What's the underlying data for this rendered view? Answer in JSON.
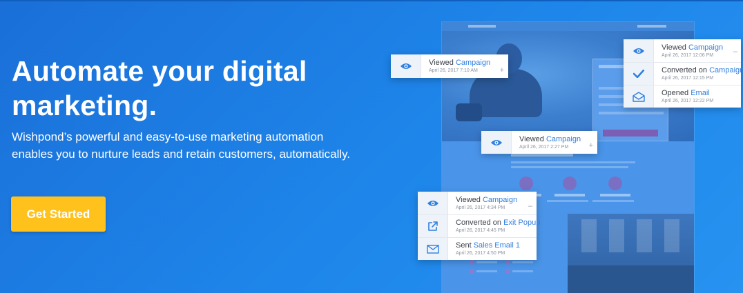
{
  "hero": {
    "title": "Automate your digital marketing.",
    "description": "Wishpond’s powerful and easy-to-use marketing automation enables you to nurture leads and retain customers, automatically.",
    "cta_label": "Get Started"
  },
  "colors": {
    "background": "#1e86ea",
    "cta": "#ffc21c",
    "link": "#2f7fe0",
    "icon": "#2f7fe0"
  },
  "cards": {
    "top_left": {
      "toggle": "+",
      "events": [
        {
          "icon": "eye-icon",
          "prefix": "Viewed",
          "link": "Campaign",
          "date": "April 26, 2017 7:10 AM"
        }
      ]
    },
    "top_right": {
      "toggle": "–",
      "events": [
        {
          "icon": "eye-icon",
          "prefix": "Viewed",
          "link": "Campaign",
          "date": "April 26, 2017 12:06 PM"
        },
        {
          "icon": "checkmark-icon",
          "prefix": "Converted on",
          "link": "Campaign",
          "date": "April 26, 2017 12:15 PM"
        },
        {
          "icon": "envelope-open-icon",
          "prefix": "Opened",
          "link": "Email",
          "date": "April 26, 2017 12:22 PM"
        }
      ]
    },
    "middle": {
      "toggle": "+",
      "events": [
        {
          "icon": "eye-icon",
          "prefix": "Viewed",
          "link": "Campaign",
          "date": "April 26, 2017 2:27 PM"
        }
      ]
    },
    "bottom": {
      "toggle": "–",
      "events": [
        {
          "icon": "eye-icon",
          "prefix": "Viewed",
          "link": "Campaign",
          "date": "April 26, 2017 4:34 PM"
        },
        {
          "icon": "external-link-icon",
          "prefix": "Converted on",
          "link": "Exit Popup",
          "date": "April 26, 2017 4:45 PM"
        },
        {
          "icon": "envelope-icon",
          "prefix": "Sent",
          "link": "Sales Email 1",
          "date": "April 26, 2017 4:50 PM"
        }
      ]
    }
  }
}
